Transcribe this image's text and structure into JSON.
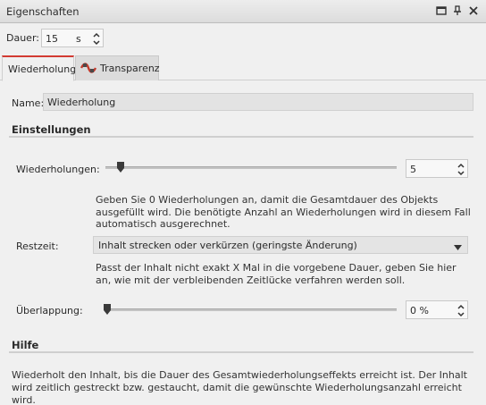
{
  "window": {
    "title": "Eigenschaften"
  },
  "dauer": {
    "label": "Dauer:",
    "value": "15",
    "unit": "s"
  },
  "tabs": [
    {
      "label": "Wiederholung",
      "active": true
    },
    {
      "label": "Transparenz",
      "active": false,
      "icon": "transparency-icon"
    }
  ],
  "name": {
    "label": "Name:",
    "value": "Wiederholung"
  },
  "einstellungen": {
    "title": "Einstellungen",
    "wiederholungen": {
      "label": "Wiederholungen:",
      "value": "5",
      "slider_fraction": 0.05,
      "hint": "Geben Sie 0 Wiederholungen an, damit die Gesamtdauer des Objekts ausgefüllt wird. Die benötigte Anzahl an Wiederholungen wird in diesem Fall automatisch ausgerechnet."
    },
    "restzeit": {
      "label": "Restzeit:",
      "value": "Inhalt strecken oder verkürzen (geringste Änderung)",
      "hint": "Passt der Inhalt nicht exakt X Mal in die vorgebene Dauer, geben Sie hier an, wie mit der verbleibenden Zeitlücke verfahren werden soll."
    },
    "ueberlappung": {
      "label": "Überlappung:",
      "value": "0 %",
      "slider_fraction": 0.0
    }
  },
  "hilfe": {
    "title": "Hilfe",
    "text": "Wiederholt den Inhalt, bis die Dauer des Gesamtwiederholungseffekts erreicht ist. Der Inhalt wird zeitlich gestreckt bzw. gestaucht, damit die gewünschte Wiederholungsanzahl erreicht wird."
  },
  "colors": {
    "accent": "#d23a32",
    "background": "#f0f0f0"
  }
}
